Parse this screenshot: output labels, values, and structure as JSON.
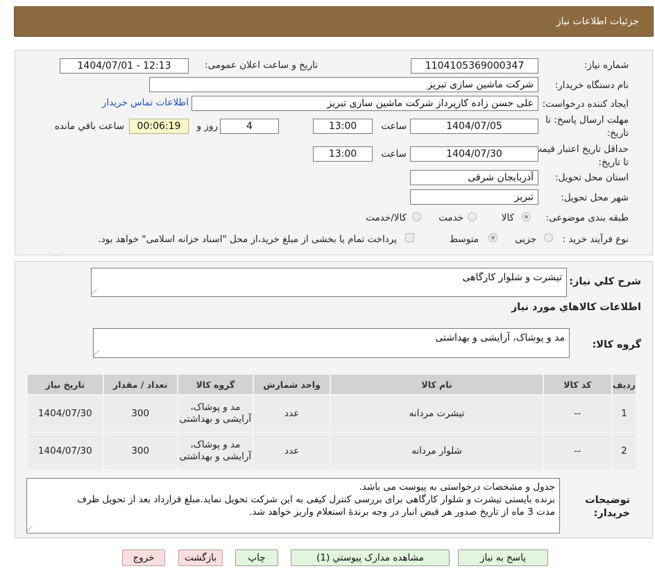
{
  "header": {
    "title": "جزئیات اطلاعات نیاز"
  },
  "watermark": {
    "text": "AriaTender.net"
  },
  "form": {
    "need_number_label": "شماره نیاز:",
    "need_number": "1104105369000347",
    "announce_label": "تاریخ و ساعت اعلان عمومی:",
    "announce_value": "1404/07/01 - 12:13",
    "buyer_org_label": "نام دستگاه خریدار:",
    "buyer_org": "شرکت ماشین سازی تبریز",
    "requester_label": "ایجاد کننده درخواست:",
    "requester": "علی حسن زاده کارپرداز شرکت ماشین سازی تبریز",
    "contact_link": "اطلاعات تماس خریدار",
    "reply_deadline_label": "مهلت ارسال پاسخ: تا تاریخ:",
    "reply_date": "1404/07/05",
    "time_label": "ساعت",
    "reply_time": "13:00",
    "days_value": "4",
    "days_label": "روز و",
    "remaining_time": "00:06:19",
    "remaining_label": "ساعت باقي مانده",
    "price_validity_label": "حداقل تاریخ اعتبار قیمت: تا تاریخ:",
    "price_validity_date": "1404/07/30",
    "price_validity_time": "13:00",
    "province_label": "استان محل تحویل:",
    "province": "آذربایجان شرقی",
    "city_label": "شهر محل تحویل:",
    "city": "تبریز",
    "category_label": "طبقه بندی موضوعی:",
    "category_options": [
      "کالا",
      "خدمت",
      "کالا/خدمت"
    ],
    "category_selected": "کالا",
    "process_label": "نوع فرآیند خرید :",
    "process_options": [
      "جزیی",
      "متوسط"
    ],
    "process_selected": "متوسط",
    "treasury_note": "پرداخت تمام یا بخشی از مبلغ خرید،از محل \"اسناد خزانه اسلامی\" خواهد بود."
  },
  "details": {
    "summary_label": "شرح کلي نياز:",
    "summary": "تیشرت و شلوار کارگاهی",
    "goods_info_title": "اطلاعات کالاهاي مورد نياز",
    "goods_group_label": "گروه کالا:",
    "goods_group": "مد و پوشاک، آرایشی و بهداشتی",
    "table": {
      "headers": [
        "رديف",
        "کد کالا",
        "نام کالا",
        "واحد شمارش",
        "گروه کالا",
        "تعداد / مقدار",
        "تاریخ نیاز"
      ],
      "rows": [
        [
          "1",
          "--",
          "تیشرت مردانه",
          "عدد",
          "مد و پوشاک، آرایشی و بهداشتی",
          "300",
          "1404/07/30"
        ],
        [
          "2",
          "--",
          "شلوار مردانه",
          "عدد",
          "مد و پوشاک، آرایشی و بهداشتی",
          "300",
          "1404/07/30"
        ]
      ]
    },
    "buyer_notes_label": "توضیحات خریدار:",
    "buyer_notes": [
      "جدول و مشخصات درخواستی به پیوست می باشد.",
      "برنده بایستی تیشرت و شلوار کارگاهی برای بررسی کنترل کیفی به این شرکت تحویل نماید.مبلغ قرارداد بعد از تحویل ظرف",
      "مدت 3 ماه از تاریخ صدور هر قبض انبار در وجه برندهٔ استعلام واریز خواهد شد."
    ]
  },
  "buttons": {
    "reply": "پاسخ به نياز",
    "attachments": "مشاهده مدارک پيوستي (1)",
    "print": "چاپ",
    "back": "بازگشت",
    "exit": "خروج"
  }
}
